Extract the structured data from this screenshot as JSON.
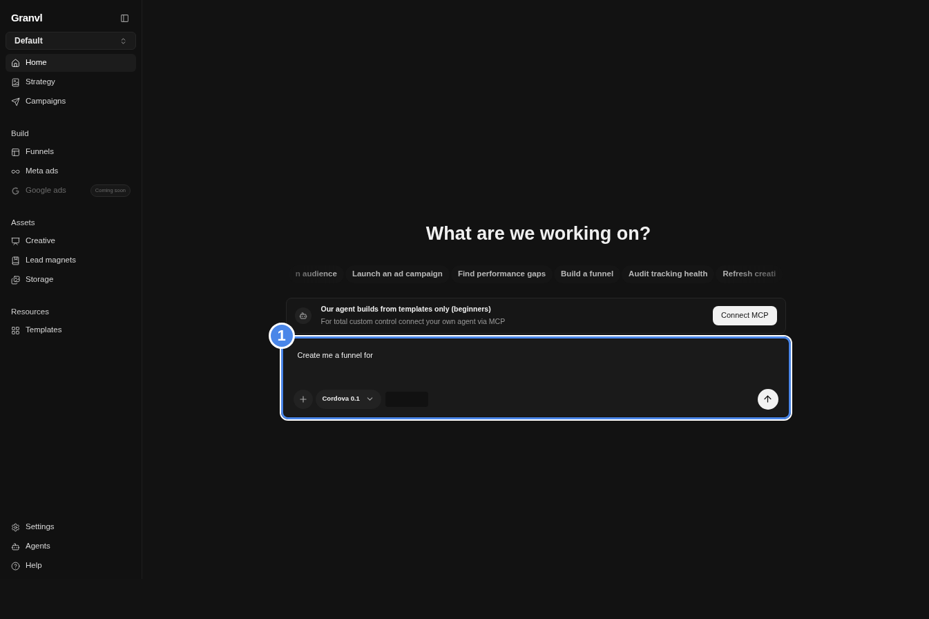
{
  "sidebar": {
    "logo": "Granvl",
    "workspace": "Default",
    "groups": [
      {
        "items": [
          {
            "label": "Home",
            "selected": true,
            "disabled": false
          },
          {
            "label": "Strategy",
            "selected": false,
            "disabled": false
          },
          {
            "label": "Campaigns",
            "selected": false,
            "disabled": false
          }
        ]
      },
      {
        "heading": "Build",
        "items": [
          {
            "label": "Funnels",
            "selected": false,
            "disabled": false
          },
          {
            "label": "Meta ads",
            "selected": false,
            "disabled": false
          },
          {
            "label": "Google ads",
            "selected": false,
            "disabled": true,
            "badge": "Coming soon"
          }
        ]
      },
      {
        "heading": "Assets",
        "items": [
          {
            "label": "Creative",
            "selected": false,
            "disabled": false
          },
          {
            "label": "Lead magnets",
            "selected": false,
            "disabled": false
          },
          {
            "label": "Storage",
            "selected": false,
            "disabled": false
          }
        ]
      },
      {
        "heading": "Resources",
        "items": [
          {
            "label": "Templates",
            "selected": false,
            "disabled": false
          }
        ]
      }
    ],
    "footer": [
      {
        "label": "Settings"
      },
      {
        "label": "Agents"
      },
      {
        "label": "Help"
      }
    ]
  },
  "main": {
    "title": "What are we working on?",
    "suggestions": [
      "n audience",
      "Launch an ad campaign",
      "Find performance gaps",
      "Build a funnel",
      "Audit tracking health",
      "Refresh creati"
    ],
    "notice": {
      "title": "Our agent builds from templates only (beginners)",
      "text": "For total custom control connect your own agent via MCP",
      "button": "Connect MCP"
    },
    "composer": {
      "value": "Create me a funnel for",
      "model": "Cordova 0.1",
      "annotation": "1"
    }
  }
}
